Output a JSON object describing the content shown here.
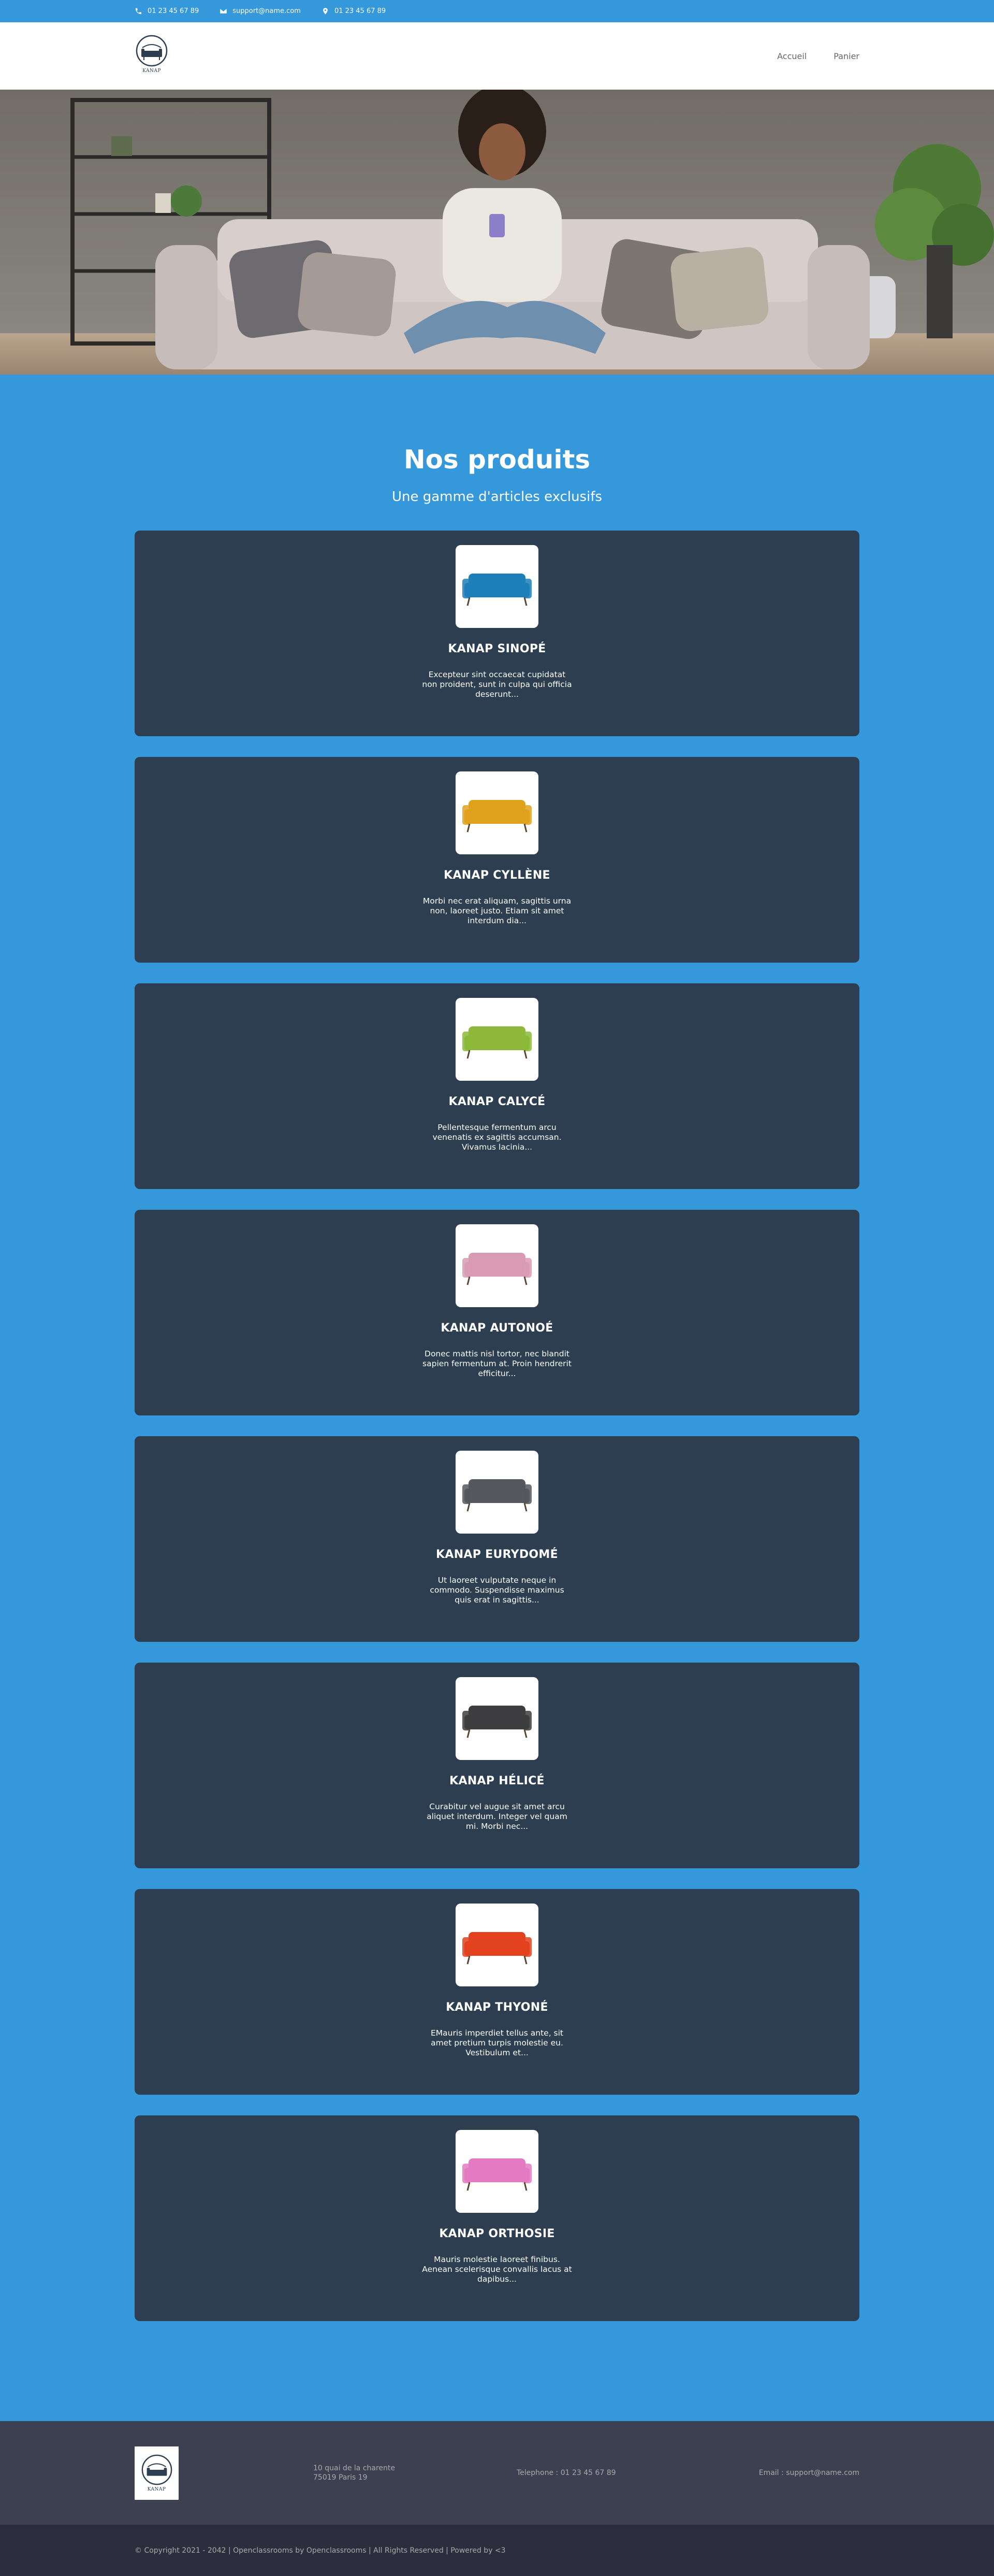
{
  "topbar": {
    "phone": "01 23 45 67 89",
    "email": "support@name.com",
    "location": "01 23 45 67 89"
  },
  "header": {
    "logo_text": "KANAP",
    "nav": [
      "Accueil",
      "Panier"
    ]
  },
  "colors": {
    "primary": "#3498db",
    "card": "#2c3e50",
    "footer": "#3d4050",
    "copyright_bar": "#2c2e3e"
  },
  "products": {
    "title": "Nos produits",
    "subtitle": "Une gamme d'articles exclusifs",
    "items": [
      {
        "name": "KANAP SINOPÉ",
        "desc": "Excepteur sint occaecat cupidatat non proident, sunt in culpa qui officia deserunt...",
        "sofa_color": "#1d7fb8"
      },
      {
        "name": "KANAP CYLLÈNE",
        "desc": "Morbi nec erat aliquam, sagittis urna non, laoreet justo. Etiam sit amet interdum dia...",
        "sofa_color": "#e0a21c"
      },
      {
        "name": "KANAP CALYCÉ",
        "desc": "Pellentesque fermentum arcu venenatis ex sagittis accumsan. Vivamus lacinia...",
        "sofa_color": "#8db83a"
      },
      {
        "name": "KANAP AUTONOÉ",
        "desc": "Donec mattis nisl tortor, nec blandit sapien fermentum at. Proin hendrerit efficitur...",
        "sofa_color": "#d99bb4"
      },
      {
        "name": "KANAP EURYDOMÉ",
        "desc": "Ut laoreet vulputate neque in commodo. Suspendisse maximus quis erat in sagittis...",
        "sofa_color": "#55585e"
      },
      {
        "name": "KANAP HÉLICÉ",
        "desc": "Curabitur vel augue sit amet arcu aliquet interdum. Integer vel quam mi. Morbi nec...",
        "sofa_color": "#3e3e40"
      },
      {
        "name": "KANAP THYONÉ",
        "desc": "EMauris imperdiet tellus ante, sit amet pretium turpis molestie eu. Vestibulum et...",
        "sofa_color": "#e2421f"
      },
      {
        "name": "KANAP ORTHOSIE",
        "desc": "Mauris molestie laoreet finibus. Aenean scelerisque convallis lacus at dapibus...",
        "sofa_color": "#e47ac2"
      }
    ]
  },
  "footer": {
    "logo_text": "KANAP",
    "address_line1": "10 quai de la charente",
    "address_line2": "75019 Paris 19",
    "telephone": "Telephone : 01 23 45 67 89",
    "email": "Email : support@name.com",
    "copyright": "© Copyright 2021 - 2042 | Openclassrooms by Openclassrooms | All Rights Reserved | Powered by <3"
  }
}
